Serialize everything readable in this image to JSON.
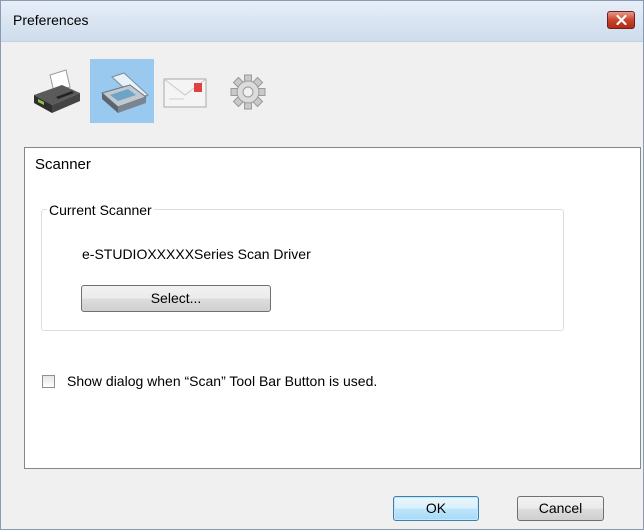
{
  "window": {
    "title": "Preferences"
  },
  "toolbar": {
    "buttons": [
      {
        "icon": "printer-icon",
        "selected": false
      },
      {
        "icon": "scanner-icon",
        "selected": true
      },
      {
        "icon": "email-icon",
        "selected": false
      },
      {
        "icon": "gear-icon",
        "selected": false
      }
    ]
  },
  "panel": {
    "title": "Scanner",
    "current_scanner": {
      "legend": "Current Scanner",
      "driver_name": "e-STUDIOXXXXXSeries Scan Driver",
      "select_label": "Select..."
    },
    "show_dialog": {
      "label": "Show dialog when “Scan” Tool Bar Button is used.",
      "checked": false
    }
  },
  "footer": {
    "ok_label": "OK",
    "cancel_label": "Cancel"
  },
  "colors": {
    "selected_tab": "#99c9ef",
    "close_button": "#c9452e"
  }
}
